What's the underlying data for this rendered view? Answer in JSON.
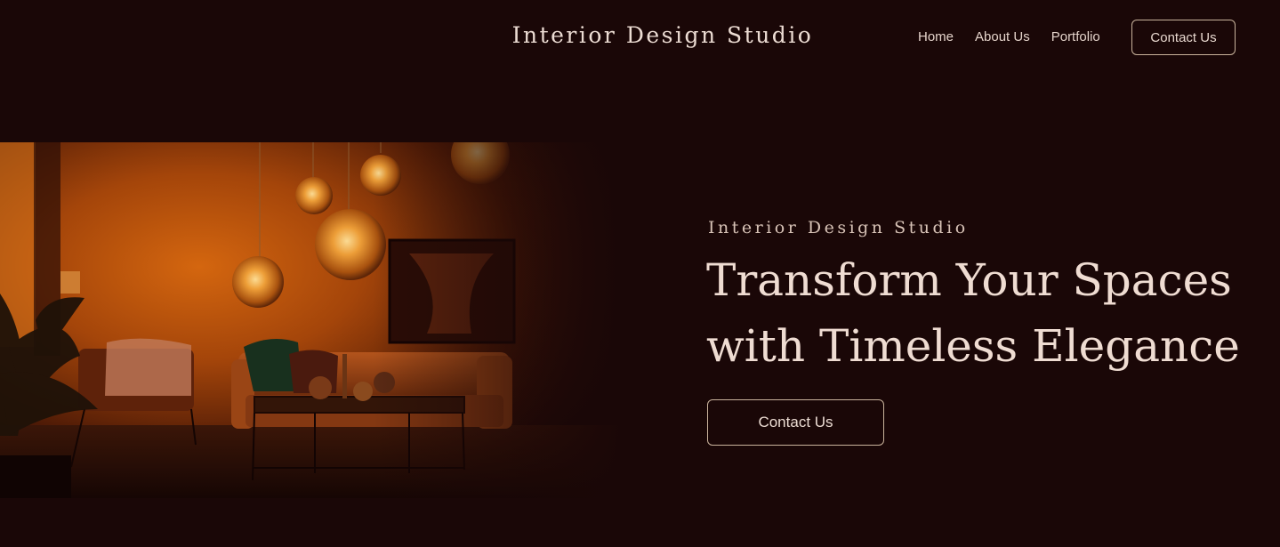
{
  "header": {
    "brand": "Interior Design Studio",
    "nav": [
      "Home",
      "About Us",
      "Portfolio"
    ],
    "cta": "Contact Us"
  },
  "hero": {
    "eyebrow": "Interior Design Studio",
    "headline_line1": "Transform Your Spaces",
    "headline_line2": "with Timeless Elegance",
    "cta": "Contact Us",
    "image_subject": "dim living room with glass pendant lamps, sofa and coffee table"
  },
  "colors": {
    "background": "#1a0707",
    "text": "#efdcd2",
    "accent_border": "#c9b39c",
    "image_glow": "#c85a10"
  }
}
